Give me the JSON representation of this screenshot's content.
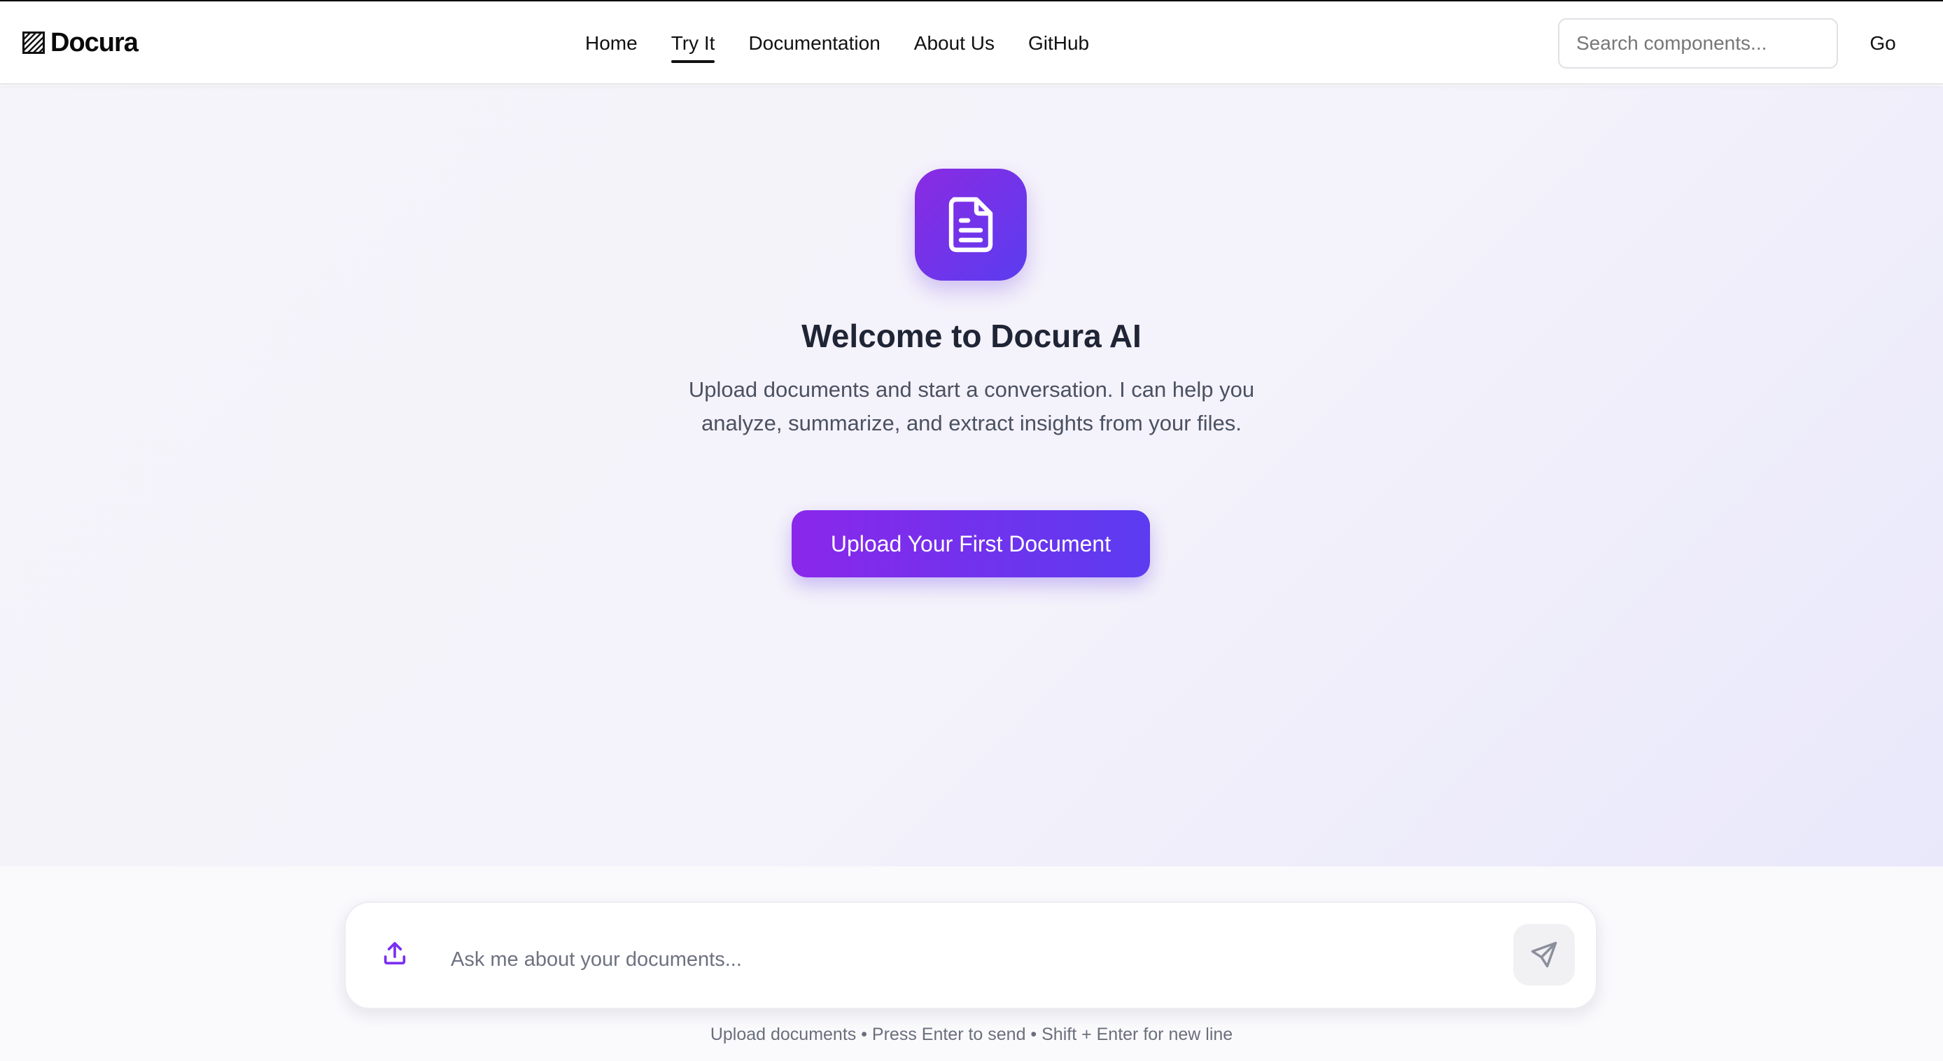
{
  "header": {
    "logo_text": "Docura",
    "nav": [
      {
        "label": "Home",
        "active": false
      },
      {
        "label": "Try It",
        "active": true
      },
      {
        "label": "Documentation",
        "active": false
      },
      {
        "label": "About Us",
        "active": false
      },
      {
        "label": "GitHub",
        "active": false
      }
    ],
    "search": {
      "placeholder": "Search components...",
      "value": ""
    },
    "go_label": "Go"
  },
  "hero": {
    "icon": "document-icon",
    "title": "Welcome to Docura AI",
    "subtitle": "Upload documents and start a conversation. I can help you analyze, summarize, and extract insights from your files.",
    "cta_label": "Upload Your First Document"
  },
  "composer": {
    "upload_icon": "upload-icon",
    "placeholder": "Ask me about your documents...",
    "value": "",
    "send_icon": "send-icon",
    "hint": "Upload documents • Press Enter to send • Shift + Enter for new line"
  },
  "colors": {
    "accent_start": "#8a2be2",
    "accent_end": "#5b3cf0",
    "title": "#1f2535",
    "body": "#4a5161"
  }
}
